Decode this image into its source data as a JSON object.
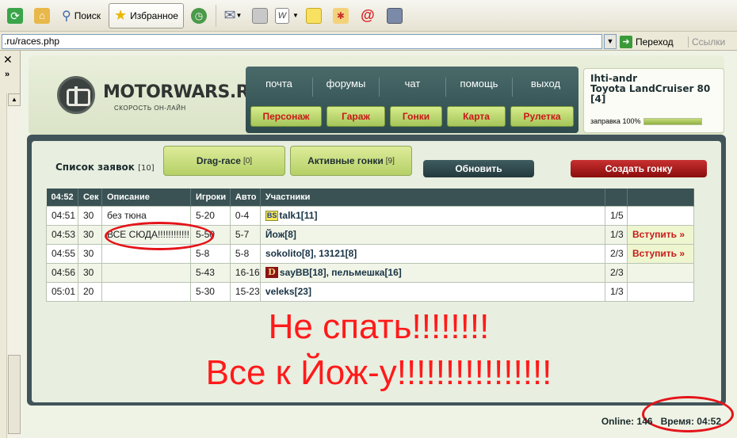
{
  "toolbar": {
    "search_label": "Поиск",
    "favorites_label": "Избранное"
  },
  "address": {
    "url": ".ru/races.php",
    "go_label": "Переход",
    "links_label": "Ссылки"
  },
  "site": {
    "logo_text": "MOTORWARS.RU",
    "logo_sub": "СКОРОСТЬ ОН-ЛАЙН",
    "nav_top": [
      "почта",
      "форумы",
      "чат",
      "помощь",
      "выход"
    ],
    "nav_bottom": [
      "Персонаж",
      "Гараж",
      "Гонки",
      "Карта",
      "Рулетка"
    ]
  },
  "user": {
    "name": "Ihti-andr",
    "car": "Toyota LandCruiser 80",
    "level": "[4]",
    "fuel_label": "заправка 100%",
    "fuel_value": 1.0
  },
  "races": {
    "list_title": "Список заявок",
    "list_count": "[10]",
    "tab_drag": "Drag-race",
    "tab_drag_count": "[0]",
    "tab_active": "Активные гонки",
    "tab_active_count": "[9]",
    "refresh_label": "Обновить",
    "create_label": "Создать гонку",
    "columns": [
      "04:52",
      "Сек",
      "Описание",
      "Игроки",
      "Авто",
      "Участники",
      "",
      ""
    ],
    "join_label": "Вступить »",
    "rows": [
      {
        "time": "04:51",
        "sec": "30",
        "desc": "без тюна",
        "players": "5-20",
        "auto": "0-4",
        "clan": "BS",
        "p1": "talk1",
        "p1lvl": "[11]",
        "p2": "",
        "p2lvl": "",
        "count": "1/5",
        "join": false
      },
      {
        "time": "04:53",
        "sec": "30",
        "desc": "ВСЕ СЮДА!!!!!!!!!!!!",
        "players": "5-50",
        "auto": "5-7",
        "clan": "",
        "p1": "Йож",
        "p1lvl": "[8]",
        "p2": "",
        "p2lvl": "",
        "count": "1/3",
        "join": true
      },
      {
        "time": "04:55",
        "sec": "30",
        "desc": "",
        "players": "5-8",
        "auto": "5-8",
        "clan": "",
        "p1": "sokolito",
        "p1lvl": "[8]",
        "p2": "13121",
        "p2lvl": "[8]",
        "count": "2/3",
        "join": true
      },
      {
        "time": "04:56",
        "sec": "30",
        "desc": "",
        "players": "5-43",
        "auto": "16-16",
        "clan": "D",
        "p1": "sayBB",
        "p1lvl": "[18]",
        "p2": "пельмешка",
        "p2lvl": "[16]",
        "count": "2/3",
        "join": false
      },
      {
        "time": "05:01",
        "sec": "20",
        "desc": "",
        "players": "5-30",
        "auto": "15-23",
        "clan": "",
        "p1": "veleks",
        "p1lvl": "[23]",
        "p2": "",
        "p2lvl": "",
        "count": "1/3",
        "join": false
      }
    ]
  },
  "overlay": {
    "line1": "Не спать!!!!!!!!",
    "line2": "Все к Йож-у!!!!!!!!!!!!!!!!"
  },
  "footer": {
    "online_label": "Online:",
    "online_value": "146",
    "time_label": "Время:",
    "time_value": "04:52"
  },
  "colors": {
    "accent_red": "#c81a1a",
    "annotation_red": "#ff1a1a",
    "header_dark": "#3a5254",
    "button_green": "#b6d067"
  }
}
